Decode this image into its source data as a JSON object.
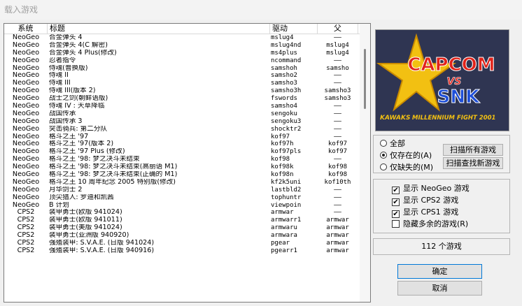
{
  "window": {
    "title": "载入游戏"
  },
  "list": {
    "columns": {
      "system": "系统",
      "title": "标题",
      "driver": "驱动",
      "parent": "父"
    },
    "rows": [
      {
        "system": "NeoGeo",
        "title": "合金弹头 4",
        "driver": "mslug4",
        "parent": "——"
      },
      {
        "system": "NeoGeo",
        "title": "合金弹头 4(C 解密)",
        "driver": "mslug4nd",
        "parent": "mslug4"
      },
      {
        "system": "NeoGeo",
        "title": "合金弹头 4 Plus(修改)",
        "driver": "ms4plus",
        "parent": "mslug4"
      },
      {
        "system": "NeoGeo",
        "title": "忍者指令",
        "driver": "ncommand",
        "parent": "——"
      },
      {
        "system": "NeoGeo",
        "title": "侍魂(普换版)",
        "driver": "samshoh",
        "parent": "samsho"
      },
      {
        "system": "NeoGeo",
        "title": "侍魂 II",
        "driver": "samsho2",
        "parent": "——"
      },
      {
        "system": "NeoGeo",
        "title": "侍魂 III",
        "driver": "samsho3",
        "parent": "——"
      },
      {
        "system": "NeoGeo",
        "title": "侍魂 III(版本 2)",
        "driver": "samsho3h",
        "parent": "samsho3"
      },
      {
        "system": "NeoGeo",
        "title": "战士之剑(朝鲜语版)",
        "driver": "fswords",
        "parent": "samsho3"
      },
      {
        "system": "NeoGeo",
        "title": "侍魂 IV : 天草降临",
        "driver": "samsho4",
        "parent": "——"
      },
      {
        "system": "NeoGeo",
        "title": "战国传承",
        "driver": "sengoku",
        "parent": "——"
      },
      {
        "system": "NeoGeo",
        "title": "战国传承 3",
        "driver": "sengoku3",
        "parent": "——"
      },
      {
        "system": "NeoGeo",
        "title": "突击骑兵: 第二分队",
        "driver": "shocktr2",
        "parent": "——"
      },
      {
        "system": "NeoGeo",
        "title": "格斗之王 '97",
        "driver": "kof97",
        "parent": "——"
      },
      {
        "system": "NeoGeo",
        "title": "格斗之王 '97(版本 2)",
        "driver": "kof97h",
        "parent": "kof97"
      },
      {
        "system": "NeoGeo",
        "title": "格斗之王 '97 Plus (修改)",
        "driver": "kof97pls",
        "parent": "kof97"
      },
      {
        "system": "NeoGeo",
        "title": "格斗之王 '98: 梦之决斗未结束",
        "driver": "kof98",
        "parent": "——"
      },
      {
        "system": "NeoGeo",
        "title": "格斗之王 '98: 梦之决斗未结束(高丽语 M1)",
        "driver": "kof98k",
        "parent": "kof98"
      },
      {
        "system": "NeoGeo",
        "title": "格斗之王 '98: 梦之决斗未结束(正确的 M1)",
        "driver": "kof98n",
        "parent": "kof98"
      },
      {
        "system": "NeoGeo",
        "title": "格斗之王 10 周年纪念 2005 特别版(修改)",
        "driver": "kf2k5uni",
        "parent": "kof10th"
      },
      {
        "system": "NeoGeo",
        "title": "月华剑士 2",
        "driver": "lastbld2",
        "parent": "——"
      },
      {
        "system": "NeoGeo",
        "title": "顶尖猎人: 罗迪和凯茜",
        "driver": "tophuntr",
        "parent": "——"
      },
      {
        "system": "NeoGeo",
        "title": "B 计划",
        "driver": "viewpoin",
        "parent": "——"
      },
      {
        "system": "CPS2",
        "title": "装甲勇士(欧版 941024)",
        "driver": "armwar",
        "parent": "——"
      },
      {
        "system": "CPS2",
        "title": "装甲勇士(欧版 941011)",
        "driver": "armwarr1",
        "parent": "armwar"
      },
      {
        "system": "CPS2",
        "title": "装甲勇士(美版 941024)",
        "driver": "armwaru",
        "parent": "armwar"
      },
      {
        "system": "CPS2",
        "title": "装甲勇士(亚洲版 940920)",
        "driver": "armwara",
        "parent": "armwar"
      },
      {
        "system": "CPS2",
        "title": "强殖装甲: S.V.A.E. (日版 941024)",
        "driver": "pgear",
        "parent": "armwar"
      },
      {
        "system": "CPS2",
        "title": "强殖装甲: S.V.A.E. (日版 940916)",
        "driver": "pgearr1",
        "parent": "armwar"
      }
    ]
  },
  "banner": {
    "brand_top": "CAPCOM",
    "vs": "VS",
    "brand_bottom": "SNK",
    "tagline": "MILLENNIUM FIGHT 2001",
    "logo_left": "KAWAKS"
  },
  "filter": {
    "options": [
      {
        "label": "全部",
        "selected": false
      },
      {
        "label": "仅存在的(A)",
        "selected": true
      },
      {
        "label": "仅缺失的(M)",
        "selected": false
      }
    ],
    "scan_all_label": "扫描所有游戏",
    "scan_new_label": "扫描查找新游戏"
  },
  "display": {
    "items": [
      {
        "label": "显示 NeoGeo 游戏",
        "checked": true
      },
      {
        "label": "显示 CPS2 游戏",
        "checked": true
      },
      {
        "label": "显示 CPS1 游戏",
        "checked": true
      },
      {
        "label": "隐藏多余的游戏(R)",
        "checked": false
      }
    ]
  },
  "count_label": "112 个游戏",
  "buttons": {
    "ok": "确定",
    "cancel": "取消"
  },
  "colors": {
    "banner_bg": "#3a3a55",
    "capcom_red": "#e2231a",
    "snk_blue": "#1e4fd8",
    "star_gold": "#f2c012"
  }
}
